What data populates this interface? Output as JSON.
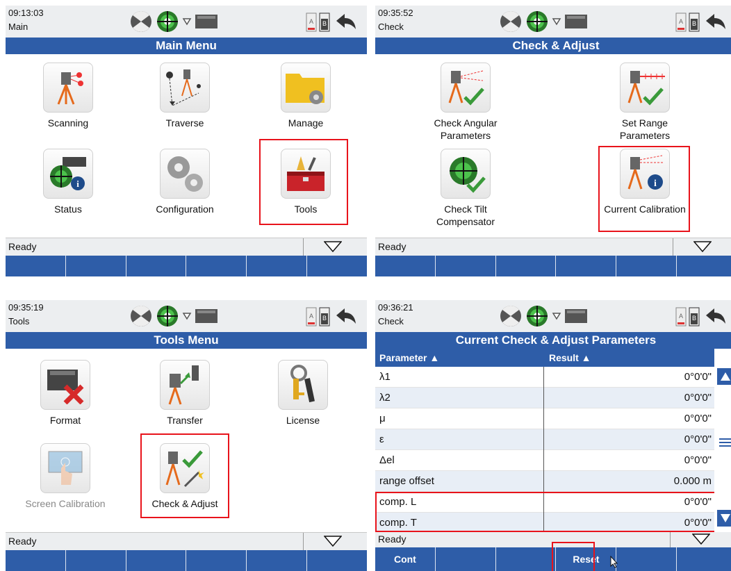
{
  "panels": {
    "main": {
      "time": "09:13:03",
      "mode": "Main",
      "title": "Main Menu",
      "tiles": [
        "Scanning",
        "Traverse",
        "Manage",
        "Status",
        "Configuration",
        "Tools"
      ],
      "status": "Ready"
    },
    "check": {
      "time": "09:35:52",
      "mode": "Check",
      "title": "Check & Adjust",
      "tiles": [
        "Check Angular Parameters",
        "Set Range Parameters",
        "Check Tilt Compensator",
        "Current Calibration"
      ],
      "status": "Ready"
    },
    "tools": {
      "time": "09:35:19",
      "mode": "Tools",
      "title": "Tools Menu",
      "tiles": [
        "Format",
        "Transfer",
        "License",
        "Screen Calibration",
        "Check & Adjust"
      ],
      "status": "Ready"
    },
    "params": {
      "time": "09:36:21",
      "mode": "Check",
      "title": "Current Check & Adjust Parameters",
      "columns": [
        "Parameter ▲",
        "Result ▲"
      ],
      "rows": [
        {
          "name": "λ1",
          "value": "0°0'0\""
        },
        {
          "name": "λ2",
          "value": "0°0'0\""
        },
        {
          "name": "μ",
          "value": "0°0'0\""
        },
        {
          "name": "ε",
          "value": "0°0'0\""
        },
        {
          "name": "Δel",
          "value": "0°0'0\""
        },
        {
          "name": "range offset",
          "value": "0.000 m"
        },
        {
          "name": "comp. L",
          "value": "0°0'0\""
        },
        {
          "name": "comp. T",
          "value": "0°0'0\""
        }
      ],
      "status": "Ready",
      "fkeys": [
        "Cont",
        "",
        "",
        "Reset",
        "",
        ""
      ]
    }
  },
  "icons": {
    "header": [
      "target-icon",
      "tilt-level-icon",
      "prism-icon",
      "memory-card-icon",
      "battery-a-icon",
      "battery-b-icon",
      "back-arrow-icon"
    ]
  },
  "colors": {
    "title_bar": "#2e5da8",
    "highlight": "#e8131b",
    "header_bg": "#eceef0"
  }
}
